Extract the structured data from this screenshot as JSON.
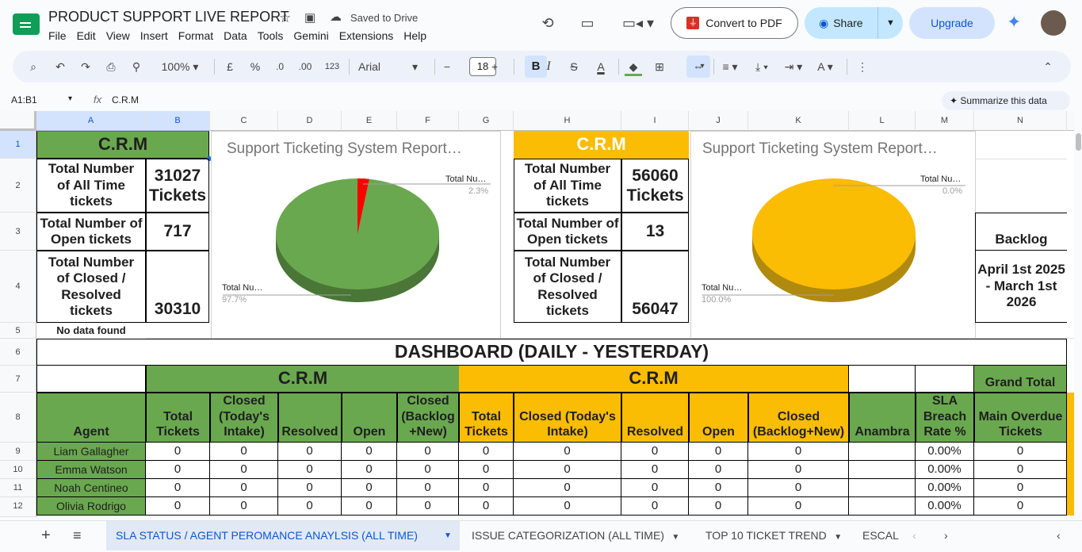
{
  "doc": {
    "title": "PRODUCT SUPPORT LIVE REPORT",
    "saved": "Saved to Drive"
  },
  "menu": [
    "File",
    "Edit",
    "View",
    "Insert",
    "Format",
    "Data",
    "Tools",
    "Gemini",
    "Extensions",
    "Help"
  ],
  "actions": {
    "convert": "Convert to PDF",
    "share": "Share",
    "upgrade": "Upgrade"
  },
  "toolbar": {
    "zoom": "100%",
    "currency": "£",
    "percent": "%",
    "dec_down": ".0",
    "dec_up": ".00",
    "numfmt": "123",
    "font": "Arial",
    "font_size": "18",
    "bold": "B",
    "italic": "I",
    "strike": "S",
    "textcolor": "A"
  },
  "formula": {
    "namebox": "A1:B1",
    "fx": "fx",
    "value": "C.R.M",
    "summarize": "Summarize this data"
  },
  "columns": [
    "A",
    "B",
    "C",
    "D",
    "E",
    "F",
    "G",
    "H",
    "I",
    "J",
    "K",
    "L",
    "M",
    "N"
  ],
  "rows": [
    "1",
    "2",
    "3",
    "4",
    "5",
    "6",
    "7",
    "8",
    "9",
    "10",
    "11",
    "12"
  ],
  "crm1": {
    "title": "C.R.M",
    "all_label": "Total Number of All Time tickets",
    "all_value": "31027 Tickets",
    "open_label": "Total Number of Open tickets",
    "open_value": "717",
    "closed_label": "Total Number of Closed / Resolved tickets",
    "closed_value": "30310",
    "nodata": "No data found"
  },
  "crm2": {
    "title": "C.R.M",
    "all_label": "Total Number of All Time tickets",
    "all_value": "56060 Tickets",
    "open_label": "Total Number of Open tickets",
    "open_value": "13",
    "closed_label": "Total Number of Closed / Resolved tickets",
    "closed_value": "56047"
  },
  "backlog": {
    "label": "Backlog",
    "period": "April 1st 2025 -  March 1st 2026"
  },
  "charts": [
    {
      "title": "Support Ticketing System Report…",
      "slice_small_label": "Total Nu…",
      "slice_small_pct": "2.3%",
      "slice_big_label": "Total Nu…",
      "slice_big_pct": "97.7%",
      "main_color": "#6aa84f",
      "small_color": "#ff0000"
    },
    {
      "title": "Support Ticketing System Report…",
      "slice_small_label": "Total Nu…",
      "slice_small_pct": "0.0%",
      "slice_big_label": "Total Nu…",
      "slice_big_pct": "100.0%",
      "main_color": "#fbbc04",
      "small_color": "#ff0000"
    }
  ],
  "dashboard": {
    "title": "DASHBOARD (DAILY - YESTERDAY)",
    "group1": "C.R.M",
    "group2": "C.R.M",
    "grand_total": "Grand Total",
    "headers": [
      "Agent",
      "Total Tickets",
      "Closed (Today's Intake)",
      "Resolved",
      "Open",
      "Closed (Backlog +New)",
      "Total Tickets",
      "Closed (Today's Intake)",
      "Resolved",
      "Open",
      "Closed (Backlog+New)",
      "Anambra",
      "SLA Breach Rate %",
      "Main Overdue Tickets"
    ],
    "rows": [
      {
        "agent": "Liam Gallagher",
        "vals": [
          "0",
          "0",
          "0",
          "0",
          "0",
          "0",
          "0",
          "0",
          "0",
          "0",
          "",
          "0.00%",
          "0"
        ]
      },
      {
        "agent": "Emma Watson",
        "vals": [
          "0",
          "0",
          "0",
          "0",
          "0",
          "0",
          "0",
          "0",
          "0",
          "0",
          "",
          "0.00%",
          "0"
        ]
      },
      {
        "agent": "Noah Centineo",
        "vals": [
          "0",
          "0",
          "0",
          "0",
          "0",
          "0",
          "0",
          "0",
          "0",
          "0",
          "",
          "0.00%",
          "0"
        ]
      },
      {
        "agent": "Olivia Rodrigo",
        "vals": [
          "0",
          "0",
          "0",
          "0",
          "0",
          "0",
          "0",
          "0",
          "0",
          "0",
          "",
          "0.00%",
          "0"
        ]
      }
    ]
  },
  "sheets": [
    "SLA STATUS / AGENT PEROMANCE ANAYLSIS (ALL TIME)",
    "ISSUE CATEGORIZATION (ALL TIME)",
    "TOP 10 TICKET TREND",
    "ESCAL"
  ]
}
